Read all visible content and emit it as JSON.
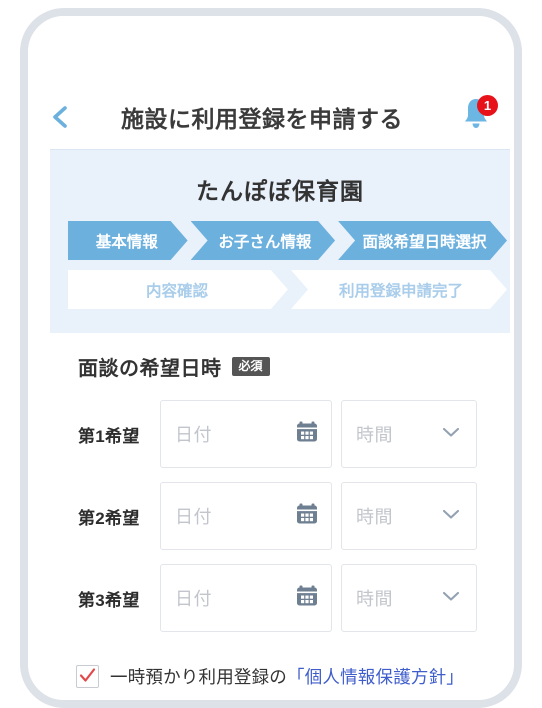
{
  "device": {
    "speaker_icon": "speaker-bar"
  },
  "header": {
    "back_icon": "chevron-left-icon",
    "title": "施設に利用登録を申請する",
    "bell_icon": "bell-icon",
    "notification_count": "1",
    "accent_color": "#6cb0de",
    "badge_color": "#e8131a"
  },
  "facility": {
    "name": "たんぽぽ保育園",
    "panel_color": "#e9f1fb",
    "steps_row1": [
      {
        "label": "基本情報",
        "state": "active"
      },
      {
        "label": "お子さん情報",
        "state": "active"
      },
      {
        "label": "面談希望日時選択",
        "state": "active"
      }
    ],
    "steps_row2": [
      {
        "label": "内容確認",
        "state": "inactive"
      },
      {
        "label": "利用登録申請完了",
        "state": "inactive"
      }
    ]
  },
  "form": {
    "section_title": "面談の希望日時",
    "required_badge": "必須",
    "rows": [
      {
        "label": "第1希望",
        "date_placeholder": "日付",
        "date_icon": "calendar-icon",
        "time_placeholder": "時間",
        "time_icon": "chevron-down-icon"
      },
      {
        "label": "第2希望",
        "date_placeholder": "日付",
        "date_icon": "calendar-icon",
        "time_placeholder": "時間",
        "time_icon": "chevron-down-icon"
      },
      {
        "label": "第3希望",
        "date_placeholder": "日付",
        "date_icon": "calendar-icon",
        "time_placeholder": "時間",
        "time_icon": "chevron-down-icon"
      }
    ]
  },
  "consent": {
    "checked": true,
    "check_icon": "check-icon",
    "check_color": "#e04a4a",
    "text_before": "一時預かり利用登録の",
    "link_text": "「個人情報保護方針」",
    "link_color": "#3f5ecb"
  }
}
